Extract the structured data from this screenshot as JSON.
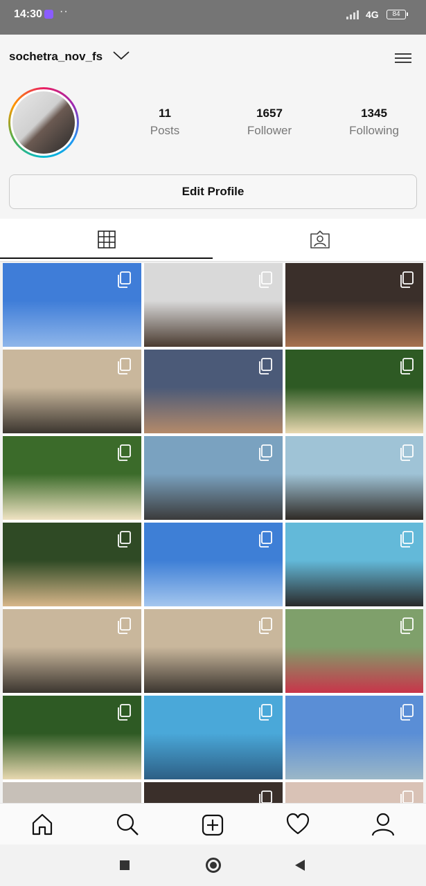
{
  "status_bar": {
    "time": "14:30",
    "network": "4G",
    "battery": "84"
  },
  "header": {
    "username": "sochetra_nov_fs",
    "dropdown_icon": "chevron-down-icon",
    "menu_icon": "hamburger-menu-icon"
  },
  "profile": {
    "avatar_ring_colors": [
      "#e91e63",
      "#9c27b0",
      "#2196f3",
      "#00bcd4",
      "#4caf50",
      "#ff9800"
    ],
    "stats": [
      {
        "value": "11",
        "label": "Posts"
      },
      {
        "value": "1657",
        "label": "Follower"
      },
      {
        "value": "1345",
        "label": "Following"
      }
    ],
    "edit_profile_label": "Edit Profile"
  },
  "tabs": [
    {
      "icon": "grid-icon",
      "active": true
    },
    {
      "icon": "tagged-person-icon",
      "active": false
    }
  ],
  "grid": {
    "tiles": [
      {
        "scene": "blue-sky",
        "colors": [
          "#3f7dd8",
          "#8fb6ea"
        ],
        "multi": true
      },
      {
        "scene": "car-selfie",
        "colors": [
          "#d9d9d9",
          "#4a3b30"
        ],
        "multi": true
      },
      {
        "scene": "beach-boy-closeup",
        "colors": [
          "#3a2f2a",
          "#a7714f"
        ],
        "multi": true
      },
      {
        "scene": "sand-digging",
        "colors": [
          "#c9b79c",
          "#3b352f"
        ],
        "multi": true
      },
      {
        "scene": "market-stall",
        "colors": [
          "#4b5a78",
          "#b48a6a"
        ],
        "multi": true
      },
      {
        "scene": "girl-sunhat-trees",
        "colors": [
          "#2e5a24",
          "#e8d8b0"
        ],
        "multi": true
      },
      {
        "scene": "girl-sunhat-trees",
        "colors": [
          "#3b6b2a",
          "#f0e3c3"
        ],
        "multi": true
      },
      {
        "scene": "roadside-friends",
        "colors": [
          "#7aa2c0",
          "#3b3b3b"
        ],
        "multi": true
      },
      {
        "scene": "beach-girl-hair",
        "colors": [
          "#9fc3d6",
          "#2f2a25"
        ],
        "multi": true
      },
      {
        "scene": "boy-hat-trees",
        "colors": [
          "#2f4a25",
          "#d7b68a"
        ],
        "multi": true
      },
      {
        "scene": "clear-sky",
        "colors": [
          "#3e7fd6",
          "#a4c6ee"
        ],
        "multi": true
      },
      {
        "scene": "sea-girl",
        "colors": [
          "#63b9d9",
          "#2a2a2a"
        ],
        "multi": true
      },
      {
        "scene": "sand-digging",
        "colors": [
          "#c9b79c",
          "#3b352f"
        ],
        "multi": true
      },
      {
        "scene": "sand-digging",
        "colors": [
          "#c9b79c",
          "#3b352f"
        ],
        "multi": true
      },
      {
        "scene": "amusement-ride",
        "colors": [
          "#7fa06b",
          "#c8354a"
        ],
        "multi": true
      },
      {
        "scene": "girl-sunhat-trees",
        "colors": [
          "#2e5a24",
          "#e8d8b0"
        ],
        "multi": true
      },
      {
        "scene": "sea-group-wave",
        "colors": [
          "#4aa8d9",
          "#2d5f85"
        ],
        "multi": true
      },
      {
        "scene": "beach-sky",
        "colors": [
          "#5a8ed6",
          "#9bb7c7"
        ],
        "multi": true
      },
      {
        "scene": "partial-1",
        "colors": [
          "#c7c0b8",
          "#6a3a3a"
        ],
        "multi": false
      },
      {
        "scene": "partial-2",
        "colors": [
          "#3a2f2a",
          "#1f1f1f"
        ],
        "multi": true
      },
      {
        "scene": "partial-3",
        "colors": [
          "#d9c2b6",
          "#4a3a34"
        ],
        "multi": true
      }
    ]
  },
  "bottom_nav": [
    {
      "icon": "home-icon"
    },
    {
      "icon": "search-icon"
    },
    {
      "icon": "new-post-icon"
    },
    {
      "icon": "heart-icon"
    },
    {
      "icon": "profile-icon"
    }
  ],
  "system_nav": [
    {
      "icon": "recents-square-icon"
    },
    {
      "icon": "home-circle-icon"
    },
    {
      "icon": "back-triangle-icon"
    }
  ]
}
